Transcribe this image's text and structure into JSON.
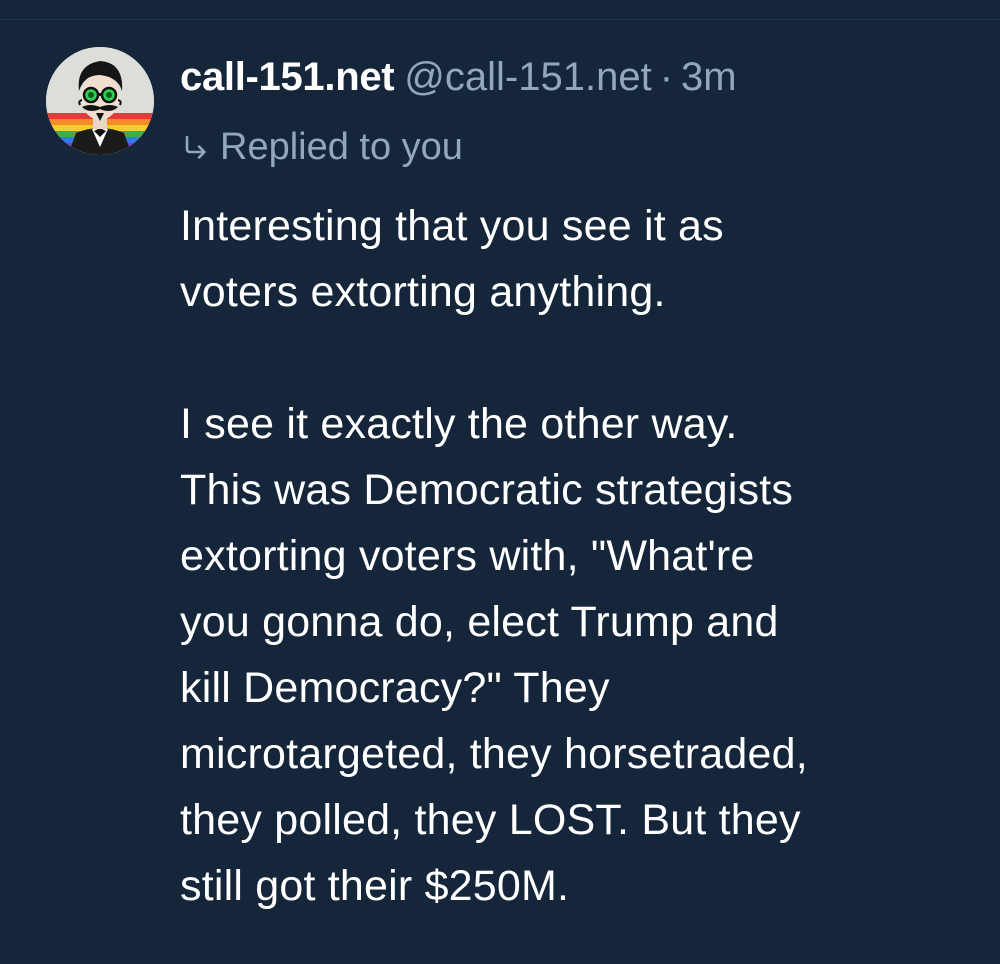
{
  "post": {
    "display_name": "call-151.net",
    "handle": "@call-151.net",
    "separator": "·",
    "time": "3m",
    "reply_indicator": {
      "icon": "reply-arrow-icon",
      "text": "Replied to you"
    },
    "avatar": {
      "icon": "mustache-man-avatar"
    },
    "body": {
      "paragraph_1": "Interesting that you see it as\nvoters extorting anything.",
      "paragraph_2": "I see it exactly the other way.\nThis was Democratic strategists\nextorting voters with, \"What're\nyou gonna do, elect Trump and\nkill Democracy?\" They\nmicrotargeted, they horsetraded,\nthey polled, they LOST. But they\nstill got their $250M."
    }
  },
  "colors": {
    "background": "#15253a",
    "primary_text": "#ffffff",
    "secondary_text": "#94a6bc"
  }
}
